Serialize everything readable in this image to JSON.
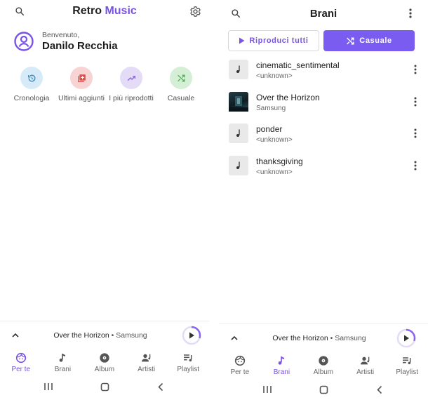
{
  "left": {
    "header": {
      "title_part1": "Retro",
      "title_part2": "Music"
    },
    "profile": {
      "greeting": "Benvenuto,",
      "name": "Danilo Recchia"
    },
    "shortcuts": [
      {
        "label": "Cronologia",
        "icon": "history-icon",
        "bg": "#d6ebf7",
        "fg": "#3c8ac3"
      },
      {
        "label": "Ultimi aggiunti",
        "icon": "playlist-add-icon",
        "bg": "#f8d3d3",
        "fg": "#d9534f"
      },
      {
        "label": "I più riprodotti",
        "icon": "trending-up-icon",
        "bg": "#e4dbf6",
        "fg": "#8f6ad8"
      },
      {
        "label": "Casuale",
        "icon": "shuffle-icon",
        "bg": "#d5eed6",
        "fg": "#4caf50"
      }
    ]
  },
  "right": {
    "header": {
      "title": "Brani"
    },
    "actions": {
      "play_all": "Riproduci tutti",
      "shuffle": "Casuale"
    },
    "songs": [
      {
        "title": "cinematic_sentimental",
        "subtitle": "<unknown>"
      },
      {
        "title": "Over the Horizon",
        "subtitle": "Samsung"
      },
      {
        "title": "ponder",
        "subtitle": "<unknown>"
      },
      {
        "title": "thanksgiving",
        "subtitle": "<unknown>"
      }
    ]
  },
  "mini_player": {
    "title": "Over the Horizon",
    "separator": "•",
    "artist": "Samsung",
    "progress": 0.3
  },
  "nav": {
    "items": [
      "Per te",
      "Brani",
      "Album",
      "Artisti",
      "Playlist"
    ],
    "left_active": "Per te",
    "right_active": "Brani"
  },
  "colors": {
    "accent": "#7a52e8",
    "button_fill": "#7a5df0"
  }
}
